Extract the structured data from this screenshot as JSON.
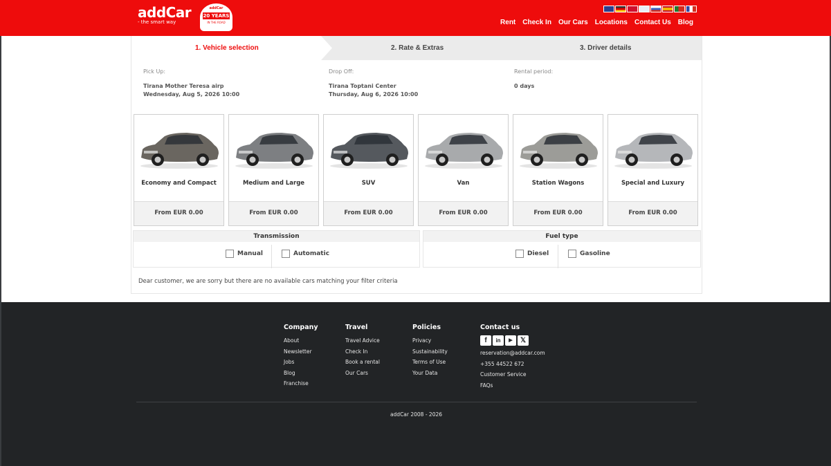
{
  "brand": {
    "name": "addCar",
    "tagline": "- the smart way",
    "badge_top": "addCar",
    "badge_years": "20 YEARS",
    "badge_bottom": "IN THE ROAD",
    "accent": "#ee0c0c"
  },
  "flags": [
    {
      "name": "uk-flag-icon",
      "color": "#2b3f8e"
    },
    {
      "name": "germany-flag-icon",
      "color": "#333333"
    },
    {
      "name": "denmark-flag-icon",
      "color": "#d0102e"
    },
    {
      "name": "finland-flag-icon",
      "color": "#2a5ab0"
    },
    {
      "name": "russia-flag-icon",
      "color": "#3b5fbf"
    },
    {
      "name": "spain-flag-icon",
      "color": "#f2b500"
    },
    {
      "name": "portugal-flag-icon",
      "color": "#1e7a2e"
    },
    {
      "name": "france-flag-icon",
      "color": "#2c4aa8"
    }
  ],
  "nav": [
    "Rent",
    "Check In",
    "Our Cars",
    "Locations",
    "Contact Us",
    "Blog"
  ],
  "steps": [
    "1. Vehicle selection",
    "2. Rate & Extras",
    "3. Driver details"
  ],
  "trip": {
    "pickup_label": "Pick Up:",
    "pickup_location": "Tirana Mother Teresa airp",
    "pickup_date": "Wednesday, Aug 5, 2026 10:00",
    "dropoff_label": "Drop Off:",
    "dropoff_location": "Tirana Toptani Center",
    "dropoff_date": "Thursday, Aug 6, 2026 10:00",
    "period_label": "Rental period:",
    "period_value": "0 days"
  },
  "categories": [
    {
      "name": "Economy and Compact",
      "price": "From EUR 0.00",
      "car_color": "#6a6660"
    },
    {
      "name": "Medium and Large",
      "price": "From EUR 0.00",
      "car_color": "#7d7f82"
    },
    {
      "name": "SUV",
      "price": "From EUR 0.00",
      "car_color": "#55595e"
    },
    {
      "name": "Van",
      "price": "From EUR 0.00",
      "car_color": "#a8aaac"
    },
    {
      "name": "Station Wagons",
      "price": "From EUR 0.00",
      "car_color": "#9c9c98"
    },
    {
      "name": "Special and Luxury",
      "price": "From EUR 0.00",
      "car_color": "#b5b7ba"
    }
  ],
  "filters": {
    "transmission": {
      "title": "Transmission",
      "options": [
        "Manual",
        "Automatic"
      ]
    },
    "fuel": {
      "title": "Fuel type",
      "options": [
        "Diesel",
        "Gasoline"
      ]
    }
  },
  "notice": "Dear customer, we are sorry but there are no available cars matching your filter criteria",
  "footer": {
    "company": {
      "title": "Company",
      "links": [
        "About",
        "Newsletter",
        "Jobs",
        "Blog",
        "Franchise"
      ]
    },
    "travel": {
      "title": "Travel",
      "links": [
        "Travel Advice",
        "Check In",
        "Book a rental",
        "Our Cars"
      ]
    },
    "policies": {
      "title": "Policies",
      "links": [
        "Privacy",
        "Sustainability",
        "Terms of Use",
        "Your Data"
      ]
    },
    "contact": {
      "title": "Contact us",
      "social": [
        "facebook-icon",
        "linkedin-icon",
        "youtube-icon",
        "x-icon"
      ],
      "email": "reservation@addcar.com",
      "phone": "+355 44522 672",
      "links": [
        "Customer Service",
        "FAQs"
      ]
    },
    "copyright": "addCar 2008 - 2026"
  }
}
